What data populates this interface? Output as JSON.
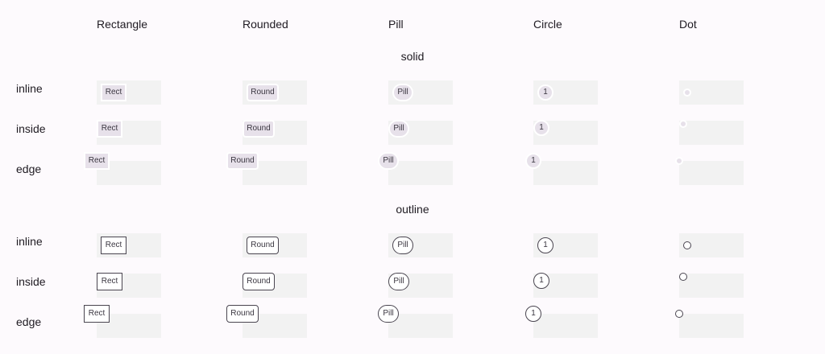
{
  "columns": [
    {
      "label": "Rectangle",
      "badge_text": "Rect"
    },
    {
      "label": "Rounded",
      "badge_text": "Round"
    },
    {
      "label": "Pill",
      "badge_text": "Pill"
    },
    {
      "label": "Circle",
      "badge_text": "1"
    },
    {
      "label": "Dot",
      "badge_text": ""
    }
  ],
  "sections": [
    {
      "title": "solid",
      "rows": [
        "inline",
        "inside",
        "edge"
      ]
    },
    {
      "title": "outline",
      "rows": [
        "inline",
        "inside",
        "edge"
      ]
    }
  ]
}
